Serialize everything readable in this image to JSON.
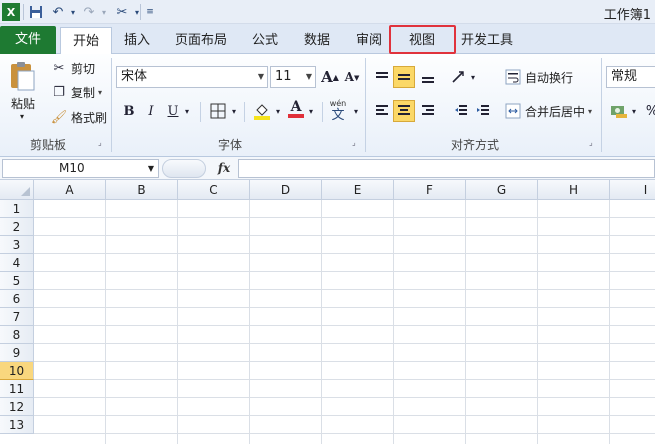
{
  "title_bar": {
    "workbook_title": "工作簿1",
    "quick_access": [
      "excel-logo-icon",
      "save-icon",
      "undo-icon",
      "redo-icon",
      "customize-tools-icon",
      "quick-access-menu-icon"
    ]
  },
  "tabs": {
    "file": "文件",
    "home": "开始",
    "insert": "插入",
    "page_layout": "页面布局",
    "formulas": "公式",
    "data": "数据",
    "review": "审阅",
    "view": "视图",
    "developer": "开发工具"
  },
  "clipboard": {
    "paste": "粘贴",
    "cut": "剪切",
    "copy": "复制",
    "format_painter": "格式刷",
    "label": "剪贴板"
  },
  "font": {
    "font_name": "宋体",
    "font_size": "11",
    "bold": "B",
    "italic": "I",
    "underline": "U",
    "font_color_glyph": "A",
    "wen": "wén",
    "wen_char": "文",
    "label": "字体"
  },
  "alignment": {
    "wrap_text": "自动换行",
    "merge_center": "合并后居中",
    "label": "对齐方式"
  },
  "number": {
    "format": "常规",
    "percent": "%"
  },
  "formula_bar": {
    "name_box": "M10",
    "fx": "fx",
    "value": ""
  },
  "grid": {
    "columns": [
      "A",
      "B",
      "C",
      "D",
      "E",
      "F",
      "G",
      "H",
      "I"
    ],
    "rows": [
      "1",
      "2",
      "3",
      "4",
      "5",
      "6",
      "7",
      "8",
      "9",
      "10",
      "11",
      "12",
      "13"
    ],
    "selected_row": "10"
  },
  "colors": {
    "file_tab": "#1e7a32",
    "highlight_box": "#e0323c",
    "selected_row_header": "#f9d77e"
  }
}
